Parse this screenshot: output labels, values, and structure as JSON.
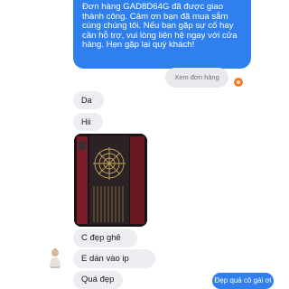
{
  "messages": {
    "top": "Đơn hàng GAD8D64G đã được giao thành công. Cảm ơn bạn đã mua sắm cùng chúng tôi. Nếu bạn gặp sự cố hay cần hỗ trợ, vui lòng liên hệ ngay với cửa hàng. Hẹn gặp lại quý khách!",
    "view_order_button": "Xem đơn hàng",
    "da": "Da",
    "hii": "Hii",
    "cdep": "C đẹp ghê ah",
    "edan": "E dán vào ip lưng",
    "quadep": "Quá đẹp",
    "last": "Đẹp quá cô gái ơi"
  },
  "icons": {
    "status_dot": "orange-circle-icon",
    "emoji": "heart-eyes-emoji-icon"
  },
  "colors": {
    "sent_bubble": "#2f80ee",
    "received_bubble": "#eceef1",
    "status_dot": "#ef7a28"
  }
}
